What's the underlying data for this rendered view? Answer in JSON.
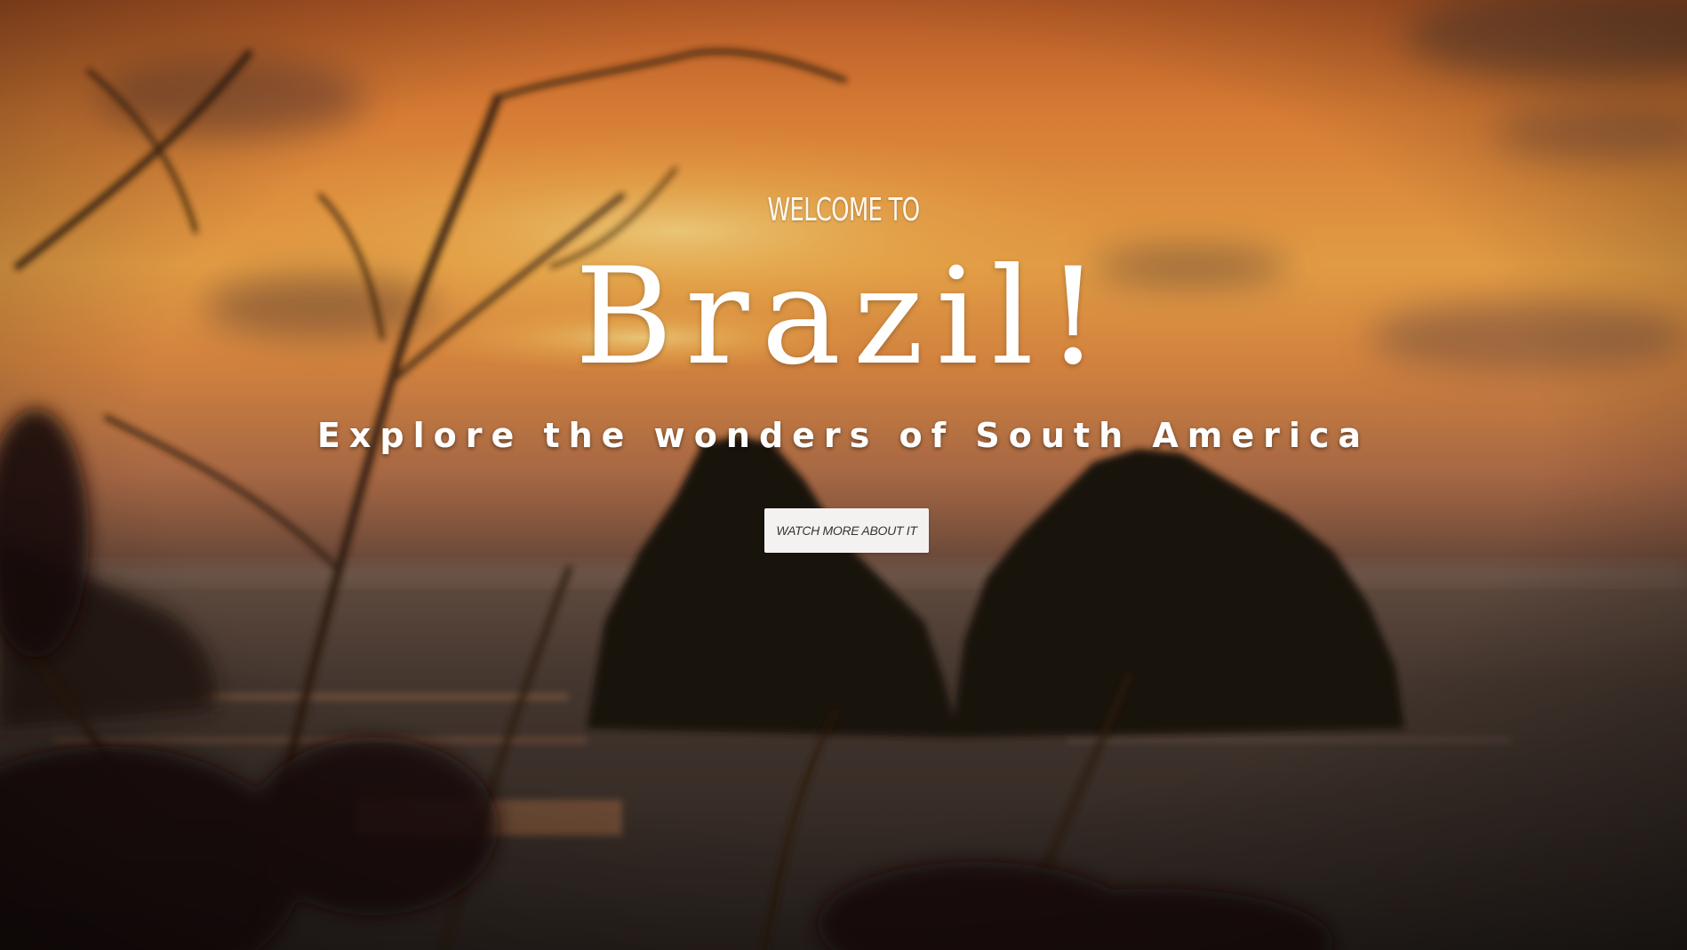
{
  "hero": {
    "kicker": "WELCOME TO",
    "title": "Brazil!",
    "subtitle": "Explore the wonders of South America",
    "cta_label": "WATCH MORE ABOUT IT"
  },
  "background": {
    "image_name": "sunset-sea-rocks-photo",
    "colors": {
      "sky_top": "#c8662b",
      "sky_glow": "#f4b24e",
      "sea": "#3a2d27",
      "rocks": "#1c130e"
    }
  }
}
